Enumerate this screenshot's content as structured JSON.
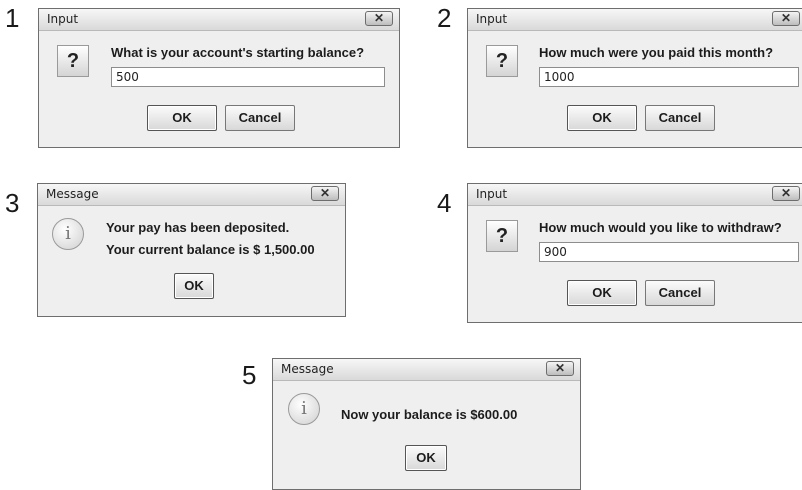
{
  "steps": [
    "1",
    "2",
    "3",
    "4",
    "5"
  ],
  "dialogs": [
    {
      "title": "Input",
      "icon": "question-icon",
      "icon_glyph": "?",
      "message": "What is your account's starting balance?",
      "input_value": "500",
      "ok_label": "OK",
      "cancel_label": "Cancel",
      "close_glyph": "✕"
    },
    {
      "title": "Input",
      "icon": "question-icon",
      "icon_glyph": "?",
      "message": "How much were you paid this month?",
      "input_value": "1000",
      "ok_label": "OK",
      "cancel_label": "Cancel",
      "close_glyph": "✕"
    },
    {
      "title": "Message",
      "icon": "info-icon",
      "icon_glyph": "i",
      "message_line1": "Your pay has been deposited.",
      "message_line2": "Your current balance is $ 1,500.00",
      "ok_label": "OK",
      "close_glyph": "✕"
    },
    {
      "title": "Input",
      "icon": "question-icon",
      "icon_glyph": "?",
      "message": "How much would you like to withdraw?",
      "input_value": "900",
      "ok_label": "OK",
      "cancel_label": "Cancel",
      "close_glyph": "✕"
    },
    {
      "title": "Message",
      "icon": "info-icon",
      "icon_glyph": "i",
      "message": "Now your balance is $600.00",
      "ok_label": "OK",
      "close_glyph": "✕"
    }
  ]
}
